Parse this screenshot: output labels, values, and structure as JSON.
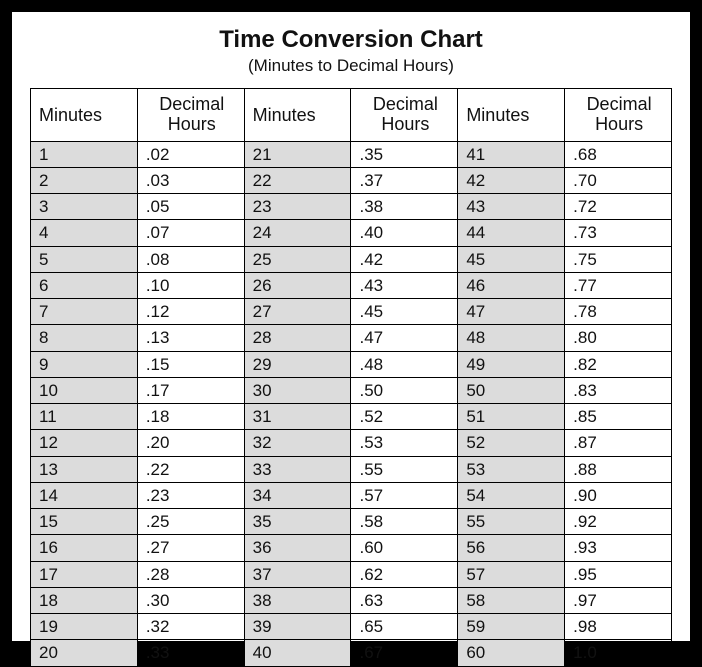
{
  "title": "Time Conversion Chart",
  "subtitle": "(Minutes to Decimal Hours)",
  "headers": {
    "minutes": "Minutes",
    "decimal": "Decimal\nHours"
  },
  "chart_data": {
    "type": "table",
    "title": "Time Conversion Chart (Minutes to Decimal Hours)",
    "columns": [
      "Minutes",
      "Decimal Hours"
    ],
    "rows": [
      [
        1,
        ".02"
      ],
      [
        2,
        ".03"
      ],
      [
        3,
        ".05"
      ],
      [
        4,
        ".07"
      ],
      [
        5,
        ".08"
      ],
      [
        6,
        ".10"
      ],
      [
        7,
        ".12"
      ],
      [
        8,
        ".13"
      ],
      [
        9,
        ".15"
      ],
      [
        10,
        ".17"
      ],
      [
        11,
        ".18"
      ],
      [
        12,
        ".20"
      ],
      [
        13,
        ".22"
      ],
      [
        14,
        ".23"
      ],
      [
        15,
        ".25"
      ],
      [
        16,
        ".27"
      ],
      [
        17,
        ".28"
      ],
      [
        18,
        ".30"
      ],
      [
        19,
        ".32"
      ],
      [
        20,
        ".33"
      ],
      [
        21,
        ".35"
      ],
      [
        22,
        ".37"
      ],
      [
        23,
        ".38"
      ],
      [
        24,
        ".40"
      ],
      [
        25,
        ".42"
      ],
      [
        26,
        ".43"
      ],
      [
        27,
        ".45"
      ],
      [
        28,
        ".47"
      ],
      [
        29,
        ".48"
      ],
      [
        30,
        ".50"
      ],
      [
        31,
        ".52"
      ],
      [
        32,
        ".53"
      ],
      [
        33,
        ".55"
      ],
      [
        34,
        ".57"
      ],
      [
        35,
        ".58"
      ],
      [
        36,
        ".60"
      ],
      [
        37,
        ".62"
      ],
      [
        38,
        ".63"
      ],
      [
        39,
        ".65"
      ],
      [
        40,
        ".67"
      ],
      [
        41,
        ".68"
      ],
      [
        42,
        ".70"
      ],
      [
        43,
        ".72"
      ],
      [
        44,
        ".73"
      ],
      [
        45,
        ".75"
      ],
      [
        46,
        ".77"
      ],
      [
        47,
        ".78"
      ],
      [
        48,
        ".80"
      ],
      [
        49,
        ".82"
      ],
      [
        50,
        ".83"
      ],
      [
        51,
        ".85"
      ],
      [
        52,
        ".87"
      ],
      [
        53,
        ".88"
      ],
      [
        54,
        ".90"
      ],
      [
        55,
        ".92"
      ],
      [
        56,
        ".93"
      ],
      [
        57,
        ".95"
      ],
      [
        58,
        ".97"
      ],
      [
        59,
        ".98"
      ],
      [
        60,
        "1.0"
      ]
    ]
  }
}
